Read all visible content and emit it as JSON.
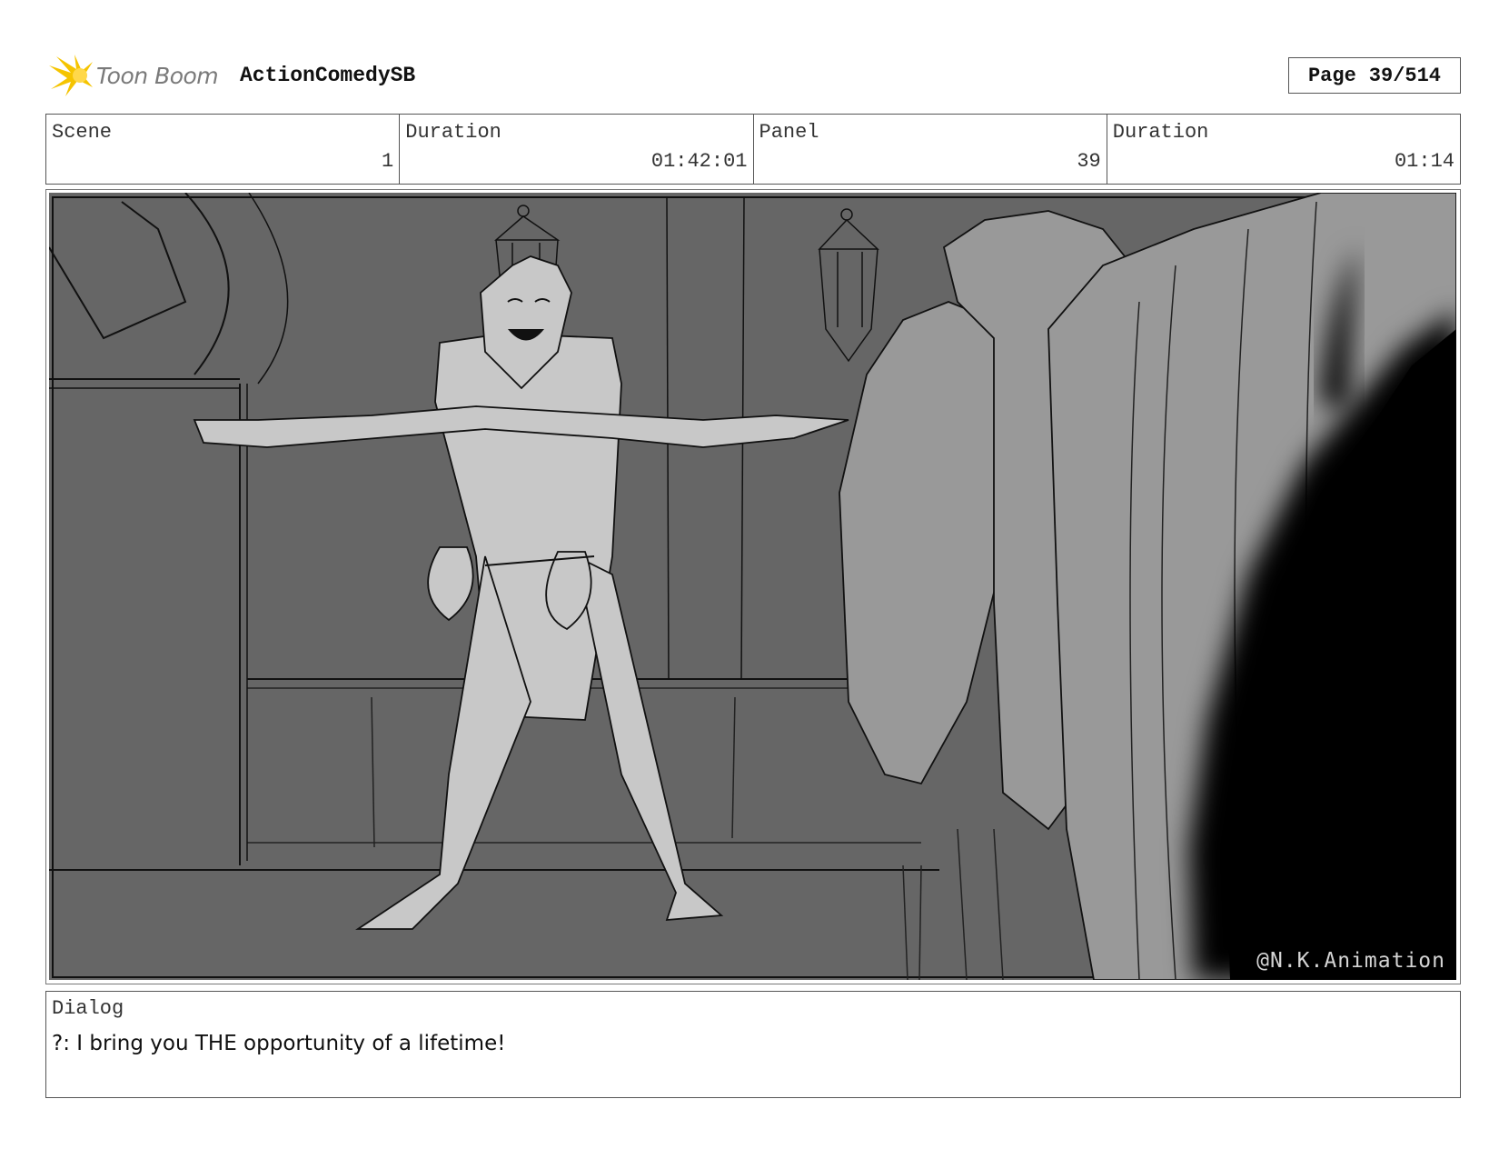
{
  "header": {
    "logo_text": "Toon Boom",
    "project_title": "ActionComedySB",
    "page_label": "Page",
    "page_value": "39/514"
  },
  "info": {
    "scene_label": "Scene",
    "scene_value": "1",
    "scene_duration_label": "Duration",
    "scene_duration_value": "01:42:01",
    "panel_label": "Panel",
    "panel_value": "39",
    "panel_duration_label": "Duration",
    "panel_duration_value": "01:14"
  },
  "panel": {
    "watermark": "@N.K.Animation"
  },
  "dialog": {
    "label": "Dialog",
    "text": "?: I bring you THE opportunity of a lifetime!"
  },
  "colors": {
    "background_wall": "#666666",
    "figure_light": "#c8c8c8",
    "figure_mid": "#999999",
    "foreground_silhouette": "#000000",
    "logo_burst": "#f5c400"
  }
}
